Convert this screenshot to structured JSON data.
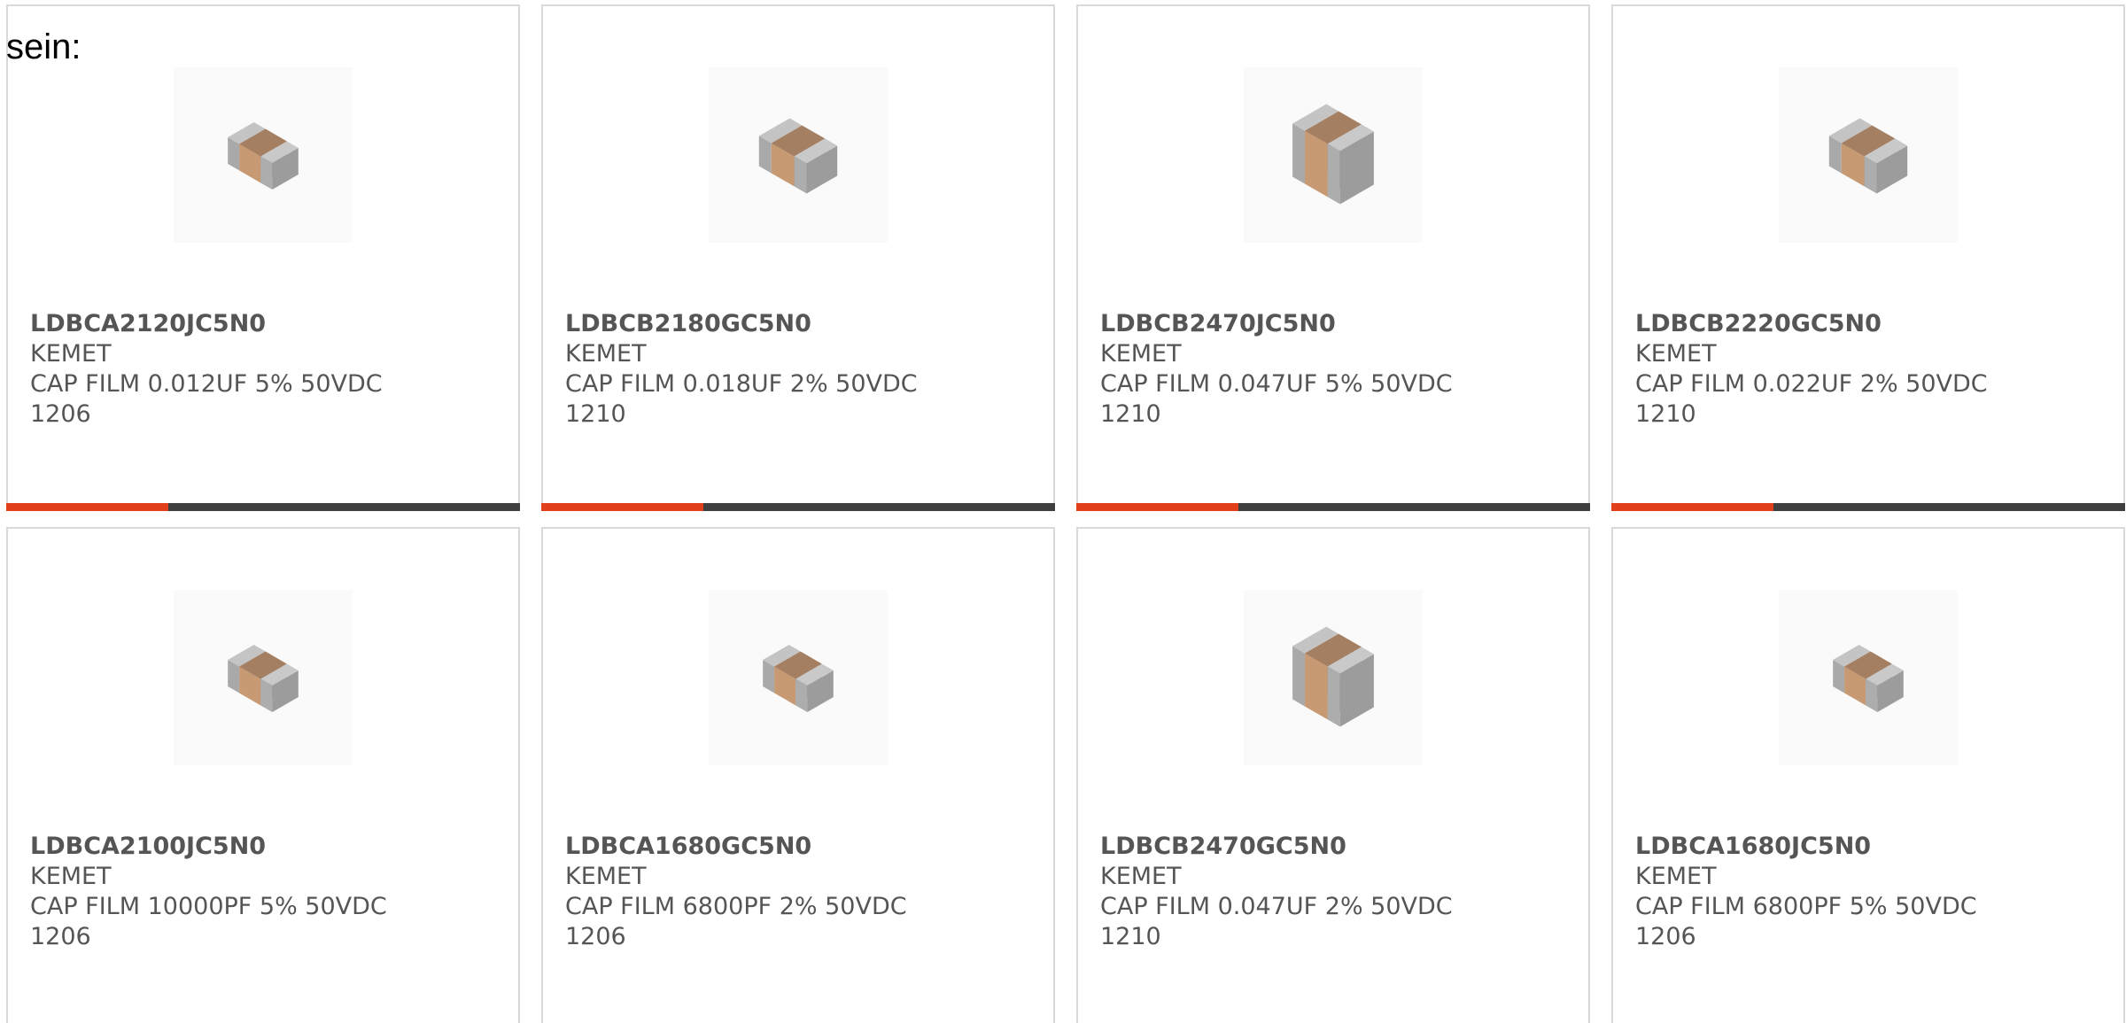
{
  "intro_text": "sein:",
  "colors": {
    "accent": "#e2401c",
    "bar_track": "#3f3f3f",
    "card_border": "#d9d9d9",
    "text": "#555555",
    "chip_body": "#a88466",
    "chip_end": "#b4b4b4"
  },
  "products": [
    {
      "part_number": "LDBCA2120JC5N0",
      "manufacturer": "KEMET",
      "description": "CAP FILM 0.012UF 5% 50VDC",
      "package": "1206",
      "image_icon": "smd-capacitor-chip-icon",
      "chip_size": "small",
      "progress": 0.315
    },
    {
      "part_number": "LDBCB2180GC5N0",
      "manufacturer": "KEMET",
      "description": "CAP FILM 0.018UF 2% 50VDC",
      "package": "1210",
      "image_icon": "smd-capacitor-chip-icon",
      "chip_size": "medium",
      "progress": 0.315
    },
    {
      "part_number": "LDBCB2470JC5N0",
      "manufacturer": "KEMET",
      "description": "CAP FILM 0.047UF 5% 50VDC",
      "package": "1210",
      "image_icon": "smd-capacitor-chip-icon",
      "chip_size": "large",
      "progress": 0.315
    },
    {
      "part_number": "LDBCB2220GC5N0",
      "manufacturer": "KEMET",
      "description": "CAP FILM 0.022UF 2% 50VDC",
      "package": "1210",
      "image_icon": "smd-capacitor-chip-icon",
      "chip_size": "medium",
      "progress": 0.315
    },
    {
      "part_number": "LDBCA2100JC5N0",
      "manufacturer": "KEMET",
      "description": "CAP FILM 10000PF 5% 50VDC",
      "package": "1206",
      "image_icon": "smd-capacitor-chip-icon",
      "chip_size": "small",
      "progress": null
    },
    {
      "part_number": "LDBCA1680GC5N0",
      "manufacturer": "KEMET",
      "description": "CAP FILM 6800PF 2% 50VDC",
      "package": "1206",
      "image_icon": "smd-capacitor-chip-icon",
      "chip_size": "small",
      "progress": null
    },
    {
      "part_number": "LDBCB2470GC5N0",
      "manufacturer": "KEMET",
      "description": "CAP FILM 0.047UF 2% 50VDC",
      "package": "1210",
      "image_icon": "smd-capacitor-chip-icon",
      "chip_size": "large",
      "progress": null
    },
    {
      "part_number": "LDBCA1680JC5N0",
      "manufacturer": "KEMET",
      "description": "CAP FILM 6800PF 5% 50VDC",
      "package": "1206",
      "image_icon": "smd-capacitor-chip-icon",
      "chip_size": "small",
      "progress": null
    }
  ]
}
